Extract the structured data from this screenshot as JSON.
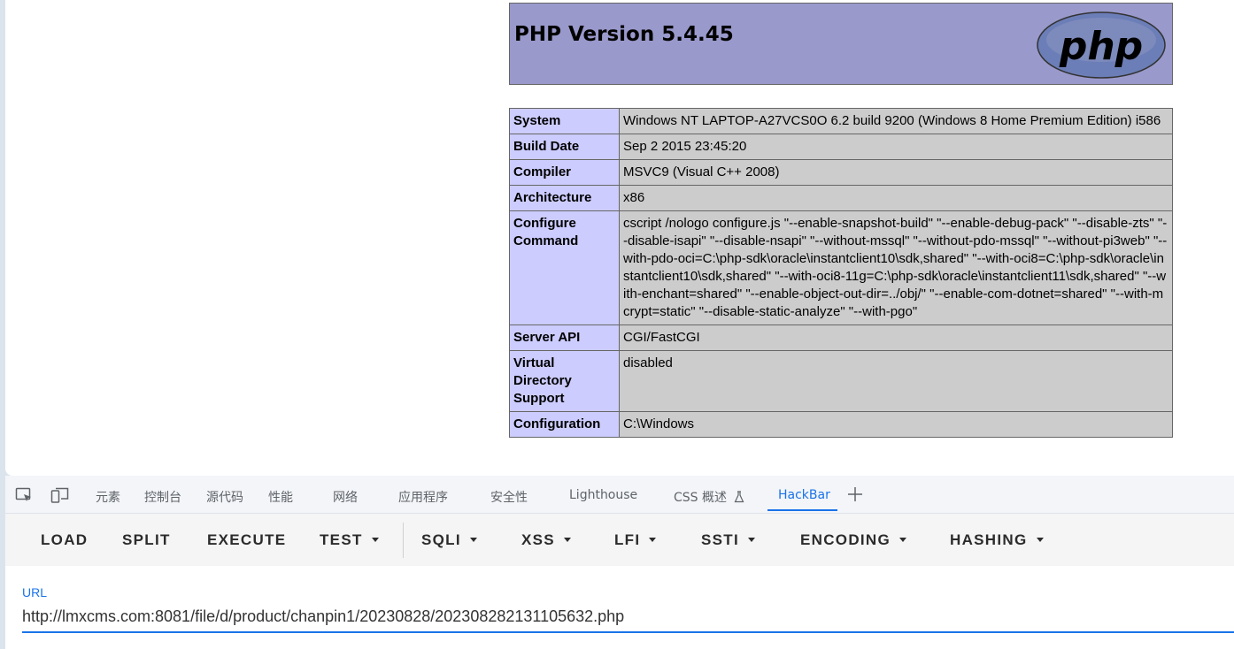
{
  "php": {
    "title": "PHP Version 5.4.45",
    "logo_text": "php",
    "rows": [
      {
        "key": "System",
        "value": "Windows NT LAPTOP-A27VCS0O 6.2 build 9200 (Windows 8 Home Premium Edition) i586"
      },
      {
        "key": "Build Date",
        "value": "Sep 2 2015 23:45:20"
      },
      {
        "key": "Compiler",
        "value": "MSVC9 (Visual C++ 2008)"
      },
      {
        "key": "Architecture",
        "value": "x86"
      },
      {
        "key": "Configure Command",
        "value": "cscript /nologo configure.js \"--enable-snapshot-build\" \"--enable-debug-pack\" \"--disable-zts\" \"--disable-isapi\" \"--disable-nsapi\" \"--without-mssql\" \"--without-pdo-mssql\" \"--without-pi3web\" \"--with-pdo-oci=C:\\php-sdk\\oracle\\instantclient10\\sdk,shared\" \"--with-oci8=C:\\php-sdk\\oracle\\instantclient10\\sdk,shared\" \"--with-oci8-11g=C:\\php-sdk\\oracle\\instantclient11\\sdk,shared\" \"--with-enchant=shared\" \"--enable-object-out-dir=../obj/\" \"--enable-com-dotnet=shared\" \"--with-mcrypt=static\" \"--disable-static-analyze\" \"--with-pgo\""
      },
      {
        "key": "Server API",
        "value": "CGI/FastCGI"
      },
      {
        "key": "Virtual Directory Support",
        "value": "disabled"
      },
      {
        "key": "Configuration",
        "value": "C:\\Windows"
      }
    ]
  },
  "devtools": {
    "tabs": [
      "元素",
      "控制台",
      "源代码",
      "性能",
      "网络",
      "应用程序",
      "安全性",
      "Lighthouse",
      "CSS 概述",
      "HackBar"
    ],
    "active_tab": "HackBar",
    "icons": [
      "inspect-element-icon",
      "device-toolbar-icon",
      "flask-icon",
      "plus-icon"
    ]
  },
  "hackbar": {
    "buttons": [
      {
        "label": "LOAD"
      },
      {
        "label": "SPLIT"
      },
      {
        "label": "EXECUTE"
      },
      {
        "label": "TEST"
      },
      {
        "label": "SQLI"
      },
      {
        "label": "XSS"
      },
      {
        "label": "LFI"
      },
      {
        "label": "SSTI"
      },
      {
        "label": "ENCODING"
      },
      {
        "label": "HASHING"
      }
    ],
    "url_label": "URL",
    "url_value": "http://lmxcms.com:8081/file/d/product/chanpin1/20230828/202308282131105632.php"
  },
  "colors": {
    "php_header": "#9999cc",
    "key_cell": "#ccccff",
    "value_cell": "#cccccc",
    "accent": "#1a73e8"
  }
}
